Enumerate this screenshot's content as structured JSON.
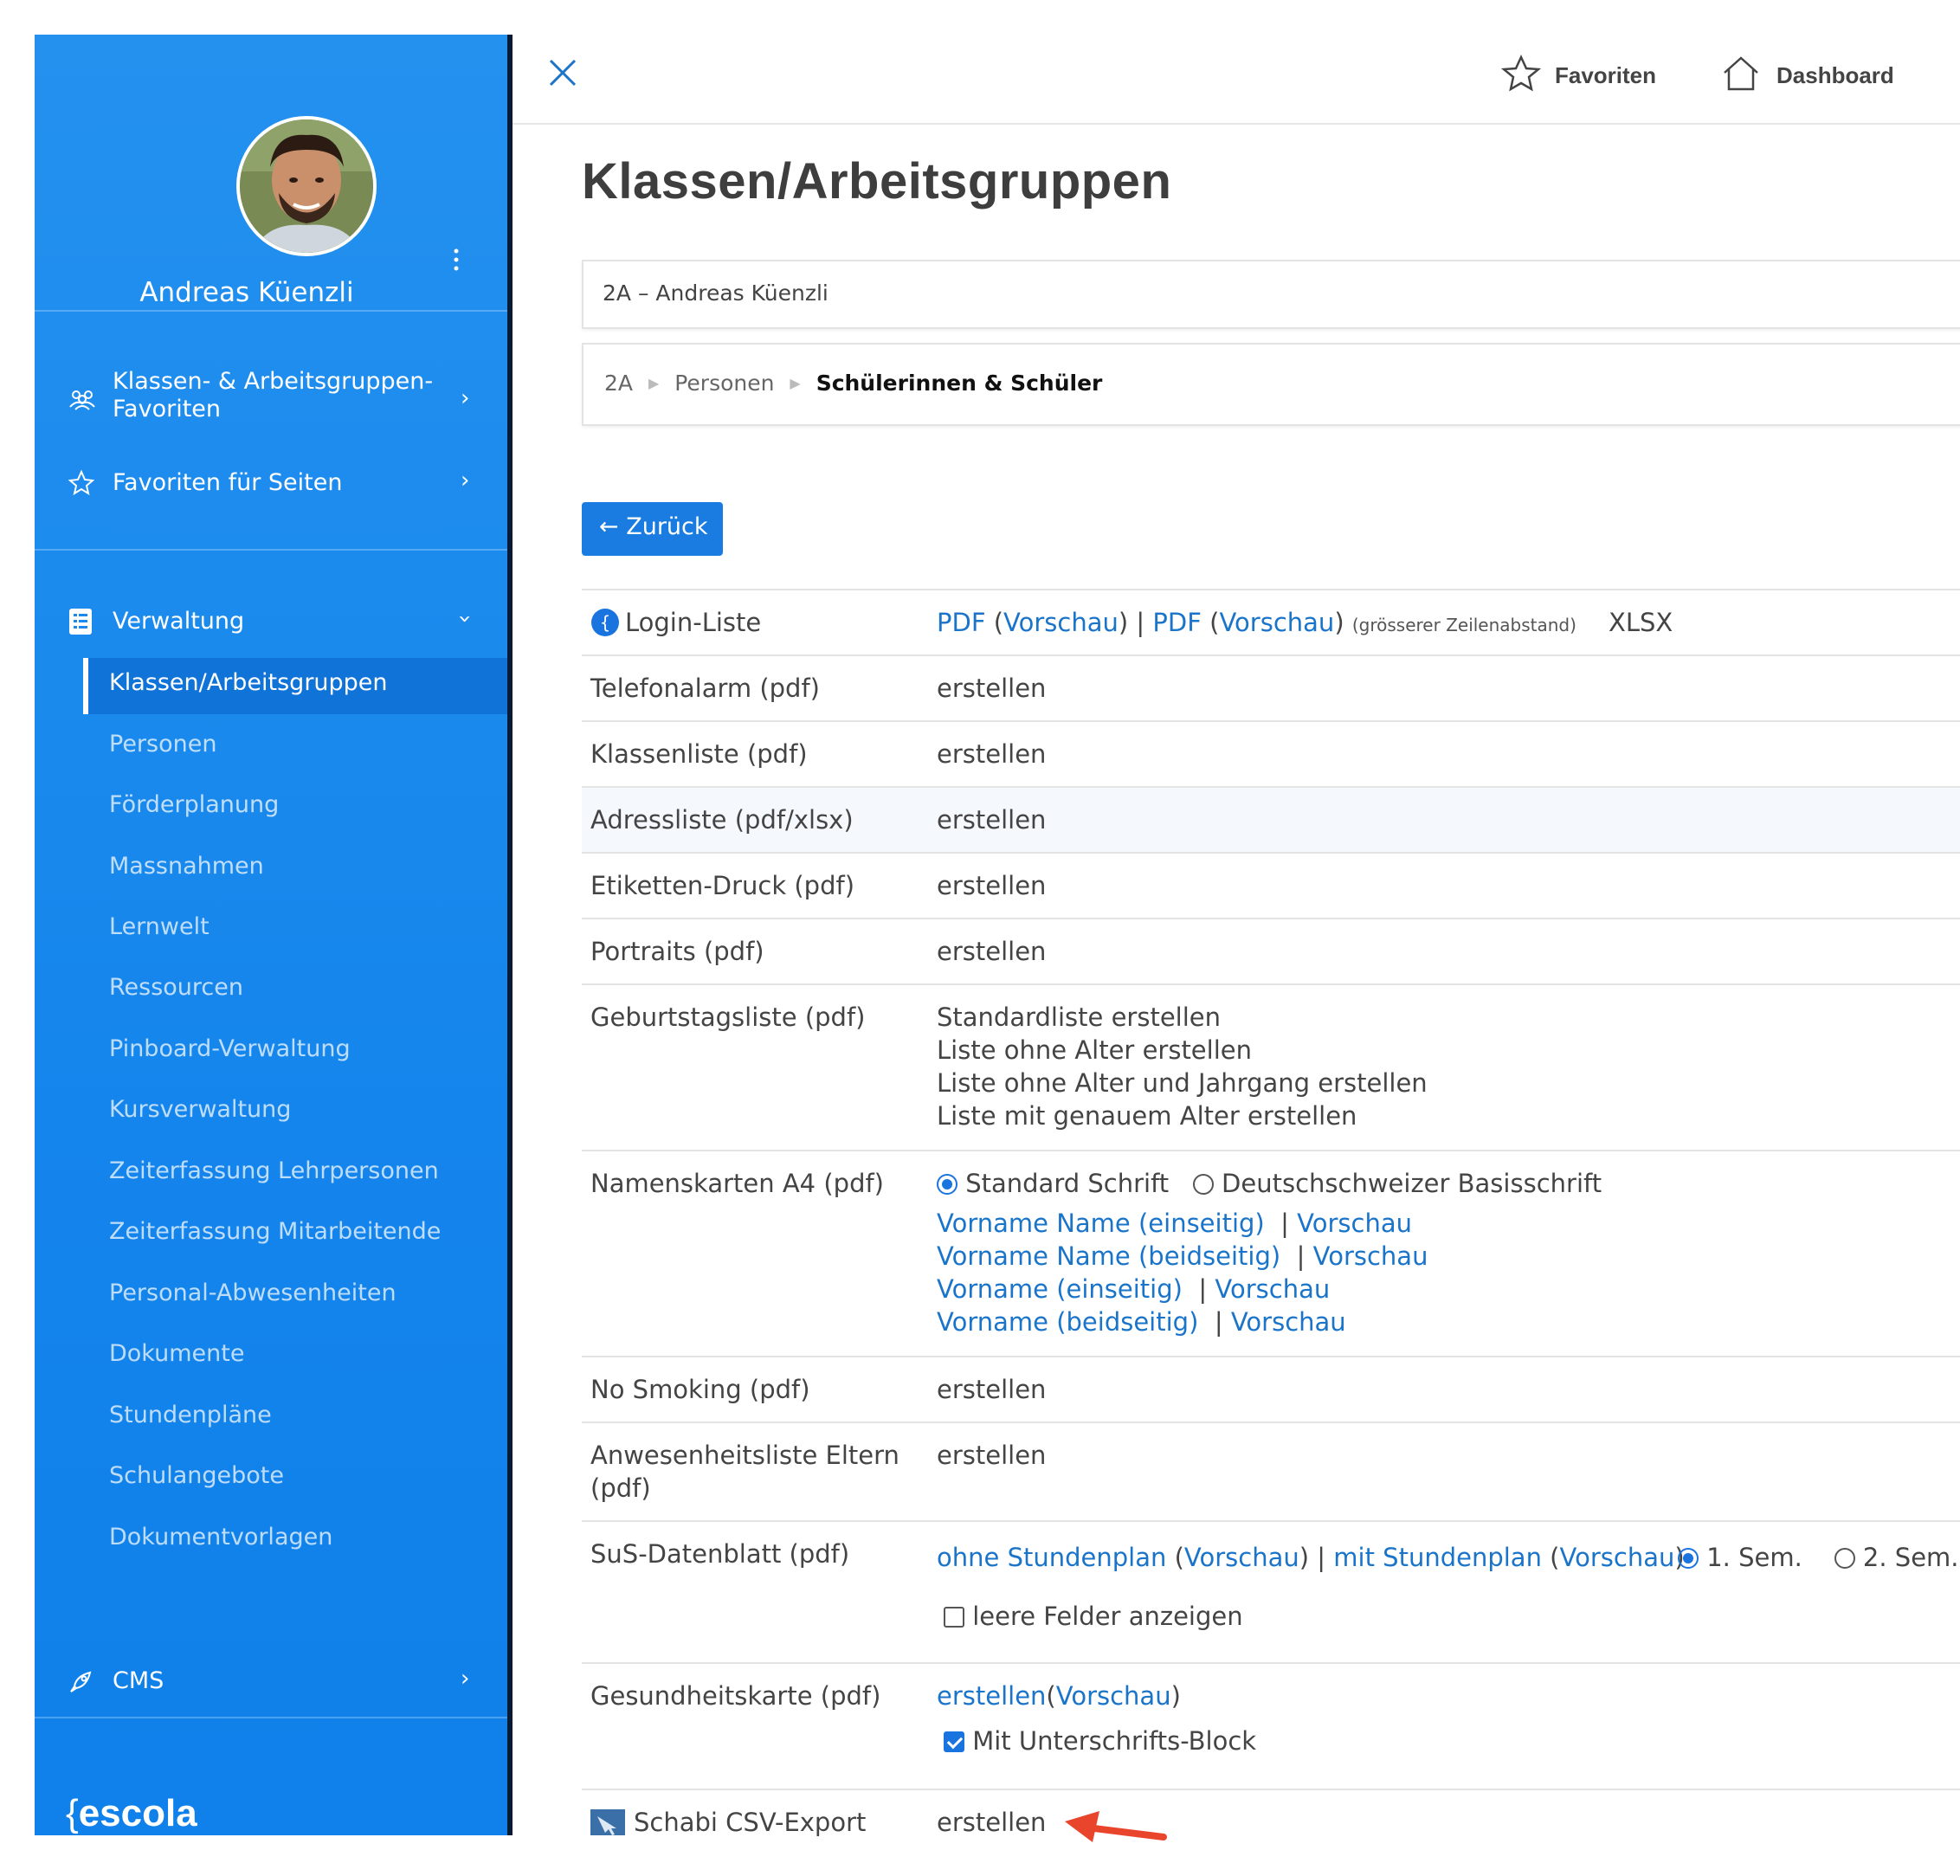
{
  "user": {
    "name": "Andreas Küenzli"
  },
  "sidebar": {
    "items": [
      {
        "label_line1": "Klassen- & Arbeitsgruppen-",
        "label_line2": "Favoriten"
      },
      {
        "label": "Favoriten für Seiten"
      },
      {
        "label": "Verwaltung"
      },
      {
        "label": "CMS"
      }
    ],
    "sub_items": [
      "Klassen/Arbeitsgruppen",
      "Personen",
      "Förderplanung",
      "Massnahmen",
      "Lernwelt",
      "Ressourcen",
      "Pinboard-Verwaltung",
      "Kursverwaltung",
      "Zeiterfassung Lehrpersonen",
      "Zeiterfassung Mitarbeitende",
      "Personal-Abwesenheiten",
      "Dokumente",
      "Stundenpläne",
      "Schulangebote",
      "Dokumentvorlagen"
    ],
    "logo_text": "escola"
  },
  "header": {
    "favorites": "Favoriten",
    "dashboard": "Dashboard"
  },
  "page": {
    "title": "Klassen/Arbeitsgruppen",
    "class_select": "2A – Andreas Küenzli",
    "breadcrumb": [
      "2A",
      "Personen",
      "Schülerinnen & Schüler"
    ],
    "back_button": "← Zurück"
  },
  "rows": {
    "login": {
      "label": "Login-Liste",
      "pdf": "PDF",
      "preview": "Vorschau",
      "note": "(grösserer Zeilenabstand)",
      "xlsx": "XLSX"
    },
    "telefonalarm": {
      "label": "Telefonalarm (pdf)",
      "link": "erstellen"
    },
    "klassenliste": {
      "label": "Klassenliste (pdf)",
      "link": "erstellen"
    },
    "adressliste": {
      "label": "Adressliste (pdf/xlsx)",
      "link": "erstellen"
    },
    "etiketten": {
      "label": "Etiketten-Druck (pdf)",
      "link": "erstellen"
    },
    "portraits": {
      "label": "Portraits (pdf)",
      "link": "erstellen"
    },
    "geburtstag": {
      "label": "Geburtstagsliste (pdf)",
      "links": [
        "Standardliste erstellen",
        "Liste ohne Alter erstellen",
        "Liste ohne Alter und Jahrgang erstellen",
        "Liste mit genauem Alter erstellen"
      ]
    },
    "namenskarten": {
      "label": "Namenskarten A4 (pdf)",
      "font_options": [
        "Standard Schrift",
        "Deutschschweizer Basisschrift"
      ],
      "selected_font": "Standard Schrift",
      "links": [
        "Vorname Name (einseitig)",
        "Vorname Name (beidseitig)",
        "Vorname (einseitig)",
        "Vorname (beidseitig)"
      ],
      "preview": "Vorschau"
    },
    "nosmoking": {
      "label": "No Smoking (pdf)",
      "link": "erstellen"
    },
    "anwesenheit": {
      "label_line1": "Anwesenheitsliste Eltern",
      "label_line2": "(pdf)",
      "link": "erstellen"
    },
    "datenblatt": {
      "label": "SuS-Datenblatt (pdf)",
      "without": "ohne Stundenplan",
      "with": "mit Stundenplan",
      "preview": "Vorschau",
      "semesters": [
        "1. Sem.",
        "2. Sem."
      ],
      "selected_semester": "1. Sem.",
      "checkbox": "leere Felder anzeigen",
      "checkbox_checked": false
    },
    "gesundheit": {
      "label": "Gesundheitskarte (pdf)",
      "link": "erstellen",
      "preview": "Vorschau",
      "checkbox": "Mit Unterschrifts-Block",
      "checkbox_checked": true
    },
    "schabi": {
      "label": "Schabi CSV-Export",
      "link": "erstellen"
    }
  },
  "colors": {
    "sidebar": "#1a88ee",
    "link": "#1a74c9",
    "button": "#1a7ce0",
    "arrow": "#e8452c"
  }
}
